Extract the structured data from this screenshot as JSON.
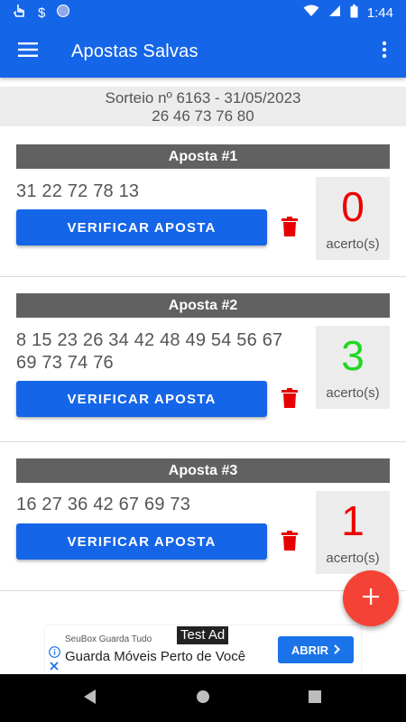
{
  "status_bar": {
    "time": "1:44",
    "icons_left": [
      "touch-icon",
      "dollar-icon",
      "circle-app-icon"
    ],
    "icons_right": [
      "wifi-icon",
      "cell-signal-icon",
      "battery-icon"
    ]
  },
  "app_bar": {
    "title": "Apostas Salvas",
    "menu_icon": "hamburger-menu-icon",
    "more_icon": "more-vert-icon",
    "color": "#1565e8"
  },
  "draw": {
    "line1": "Sorteio nº 6163 - 31/05/2023",
    "line2": "26 46 73 76 80"
  },
  "bets": [
    {
      "title": "Aposta #1",
      "numbers": "31 22 72 78 13",
      "button": "VERIFICAR APOSTA",
      "hits": "0",
      "hits_label": "acerto(s)",
      "hits_color": "#ee0000"
    },
    {
      "title": "Aposta #2",
      "numbers": "8 15 23 26 34 42 48 49 54 56 67 69 73 74 76",
      "button": "VERIFICAR APOSTA",
      "hits": "3",
      "hits_label": "acerto(s)",
      "hits_color": "#1fd81f"
    },
    {
      "title": "Aposta #3",
      "numbers": "16 27 36 42 67 69 73",
      "button": "VERIFICAR APOSTA",
      "hits": "1",
      "hits_label": "acerto(s)",
      "hits_color": "#ee0000"
    }
  ],
  "fab": {
    "icon": "plus-icon",
    "color": "#f44336"
  },
  "ad": {
    "badge": "Test Ad",
    "advertiser": "SeuBox Guarda Tudo",
    "headline": "Guarda Móveis Perto de Você",
    "cta": "ABRIR"
  },
  "nav_bar": {
    "icons": [
      "back-icon",
      "home-icon",
      "recents-icon"
    ]
  }
}
